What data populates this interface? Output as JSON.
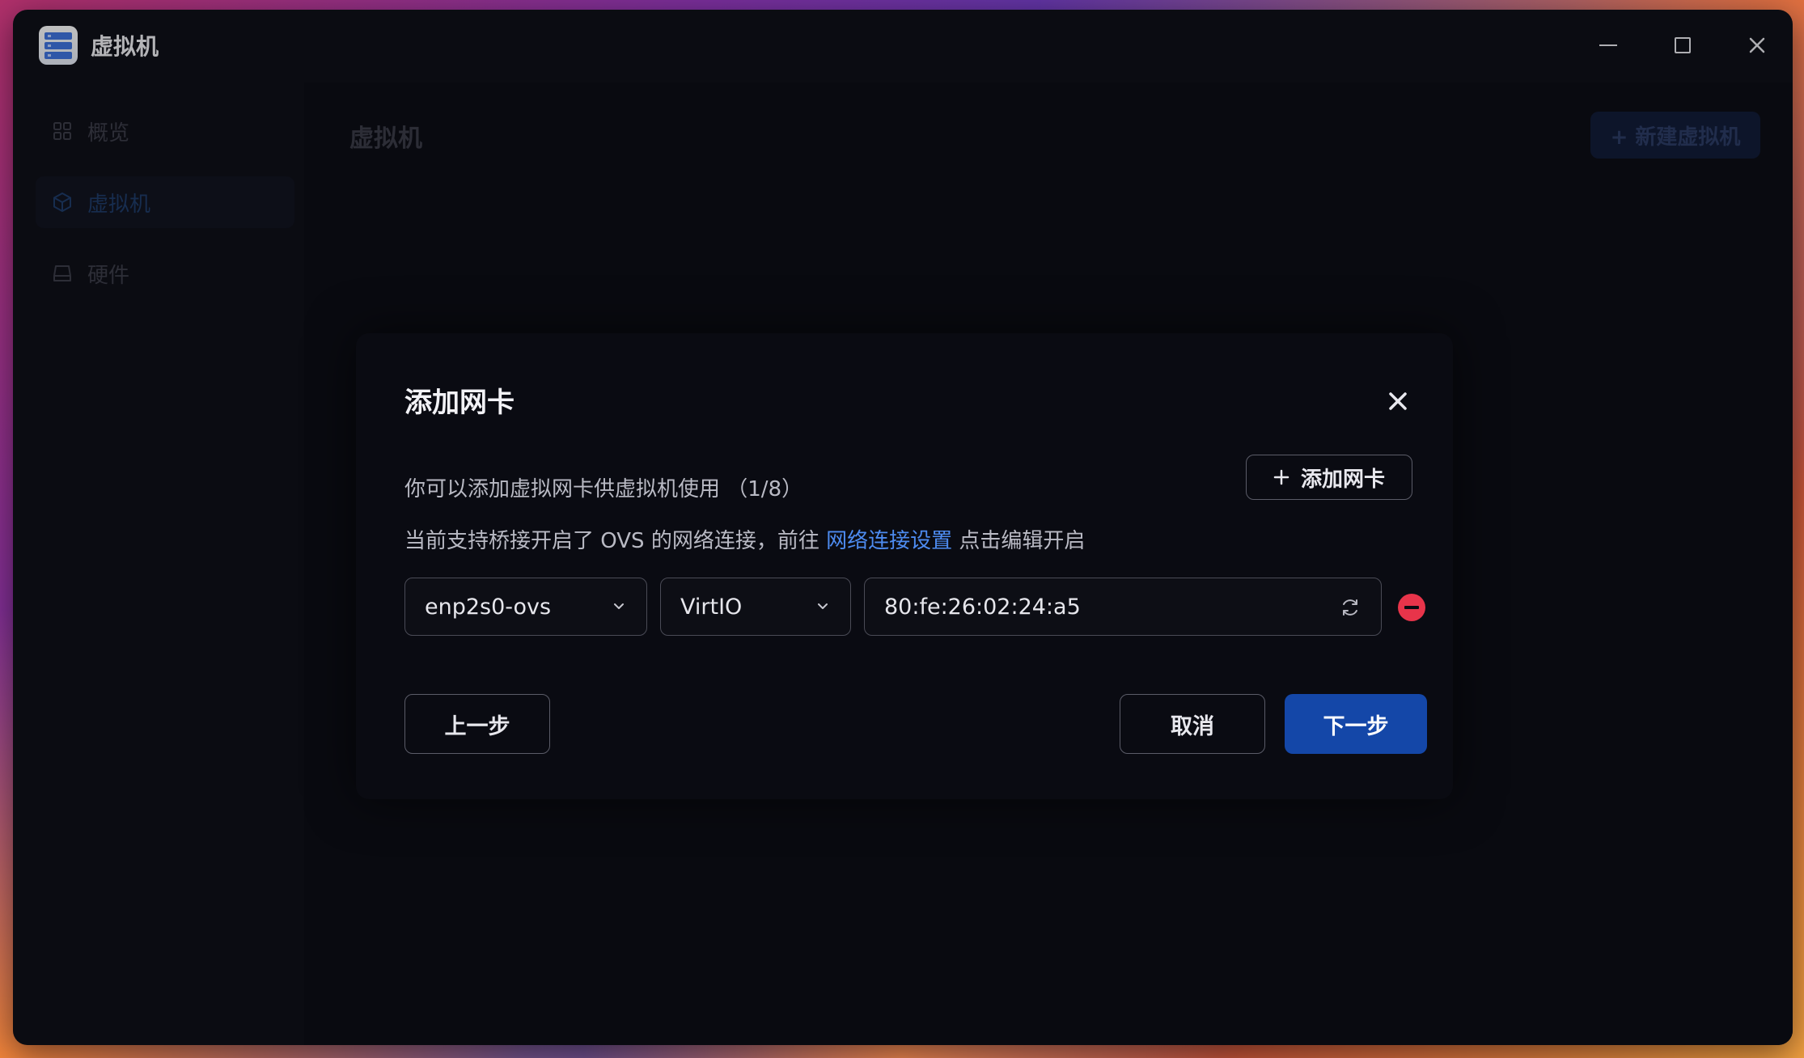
{
  "window": {
    "title": "虚拟机"
  },
  "sidebar": {
    "items": [
      {
        "label": "概览",
        "icon": "grid-icon",
        "active": false
      },
      {
        "label": "虚拟机",
        "icon": "cube-icon",
        "active": true
      },
      {
        "label": "硬件",
        "icon": "drive-icon",
        "active": false
      }
    ]
  },
  "main": {
    "title": "虚拟机",
    "new_vm_label": "+ 新建虚拟机"
  },
  "dialog": {
    "title": "添加网卡",
    "desc1": "你可以添加虚拟网卡供虚拟机使用 （1/8）",
    "desc2_prefix": "当前支持桥接开启了 OVS 的网络连接，前往 ",
    "desc2_link": "网络连接设置",
    "desc2_suffix": " 点击编辑开启",
    "add_nic_label": "添加网卡",
    "nic": {
      "network": "enp2s0-ovs",
      "model": "VirtIO",
      "mac": "80:fe:26:02:24:a5"
    },
    "prev_label": "上一步",
    "cancel_label": "取消",
    "next_label": "下一步"
  },
  "colors": {
    "accent": "#1447a8",
    "link": "#4d8bf0",
    "danger": "#e8344a",
    "background": "#0f1019"
  }
}
